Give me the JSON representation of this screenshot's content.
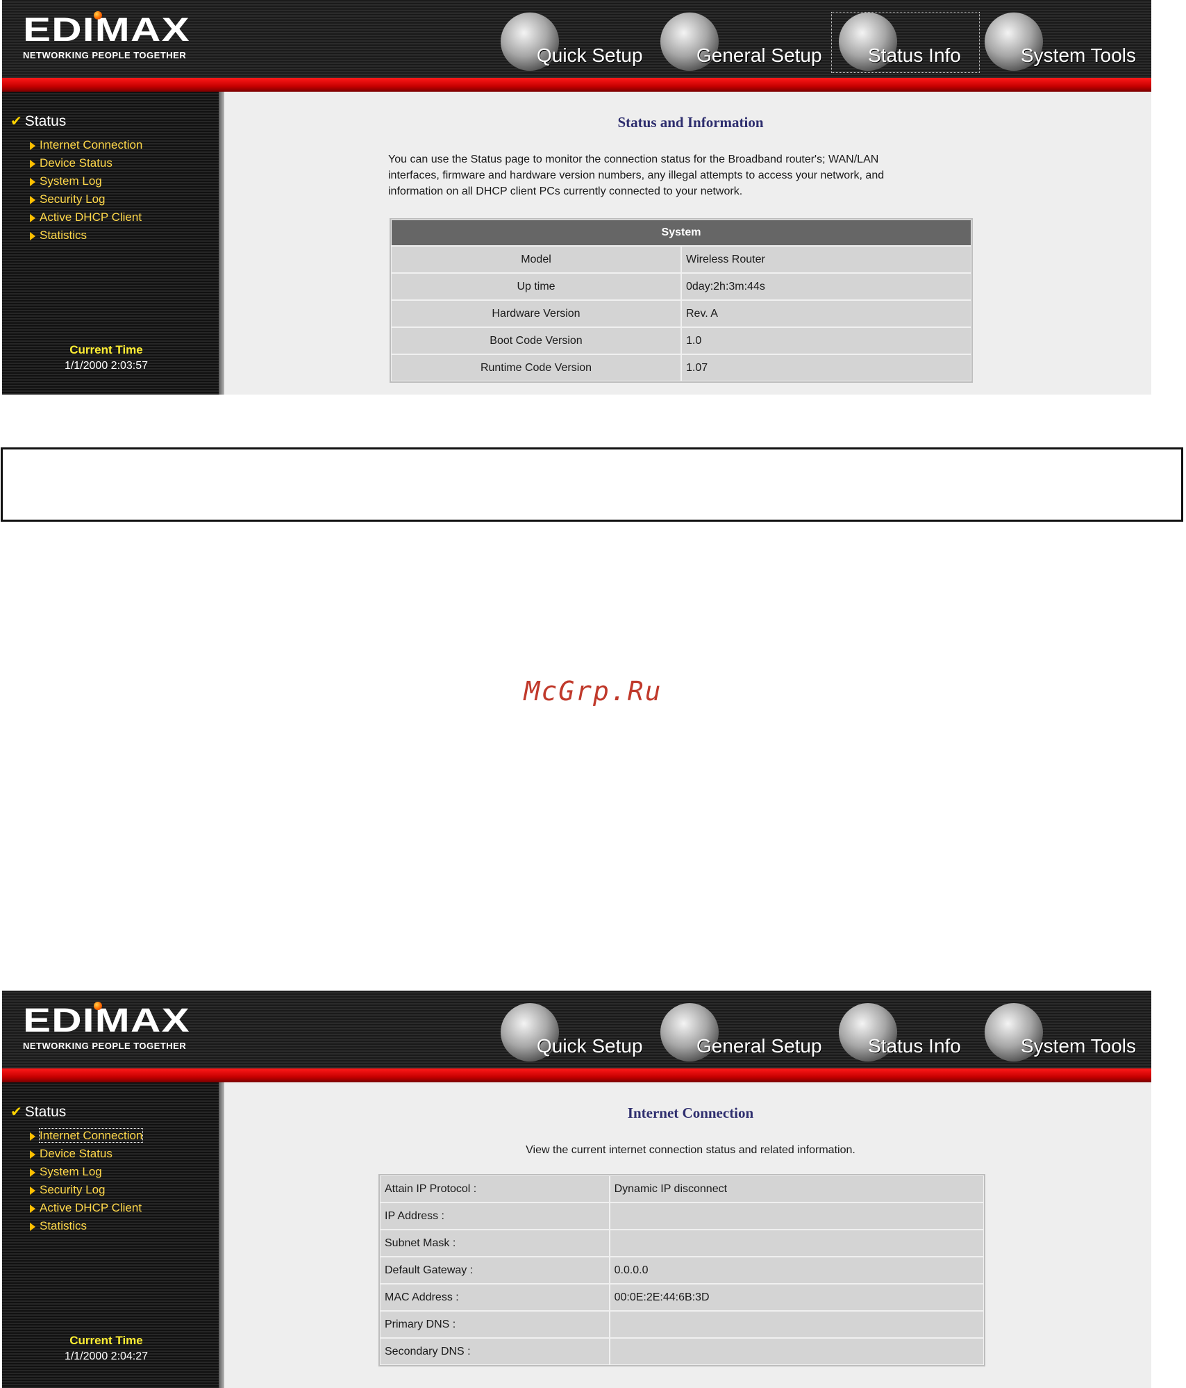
{
  "brand": {
    "name": "EDIMAX",
    "tagline": "NETWORKING PEOPLE TOGETHER"
  },
  "nav": [
    {
      "label": "Quick Setup",
      "icon": "quick-setup-icon"
    },
    {
      "label": "General Setup",
      "icon": "general-setup-icon"
    },
    {
      "label": "Status Info",
      "icon": "status-info-icon"
    },
    {
      "label": "System Tools",
      "icon": "system-tools-icon"
    }
  ],
  "sidebar": {
    "title": "Status",
    "items": [
      "Internet Connection",
      "Device Status",
      "System Log",
      "Security Log",
      "Active DHCP Client",
      "Statistics"
    ],
    "clock_label": "Current Time"
  },
  "screen1": {
    "current_time": "1/1/2000 2:03:57",
    "title": "Status and Information",
    "intro_lines": [
      "You can use the Status page to monitor the connection status for the Broadband router's; WAN/LAN",
      "interfaces, firmware and hardware version numbers, any illegal attempts to access your network, and",
      "information on all DHCP client PCs currently connected to your network."
    ],
    "table_header": "System",
    "rows": [
      {
        "label": "Model",
        "value": "Wireless Router"
      },
      {
        "label": "Up time",
        "value": "0day:2h:3m:44s"
      },
      {
        "label": "Hardware Version",
        "value": "Rev. A"
      },
      {
        "label": "Boot Code Version",
        "value": "1.0"
      },
      {
        "label": "Runtime Code Version",
        "value": "1.07"
      }
    ]
  },
  "watermark": "McGrp.Ru",
  "screen2": {
    "current_time": "1/1/2000 2:04:27",
    "title": "Internet Connection",
    "intro": "View the current internet connection status and related information.",
    "rows": [
      {
        "label": "Attain IP Protocol :",
        "value": "Dynamic IP disconnect"
      },
      {
        "label": "IP Address :",
        "value": ""
      },
      {
        "label": "Subnet Mask :",
        "value": ""
      },
      {
        "label": "Default Gateway :",
        "value": "0.0.0.0"
      },
      {
        "label": "MAC Address :",
        "value": "00:0E:2E:44:6B:3D"
      },
      {
        "label": "Primary DNS :",
        "value": ""
      },
      {
        "label": "Secondary DNS :",
        "value": ""
      }
    ]
  },
  "colors": {
    "header_red": "#d00000",
    "menu_yellow": "#ffd84a",
    "title_navy": "#2e2e6e",
    "table_header": "#666666"
  }
}
